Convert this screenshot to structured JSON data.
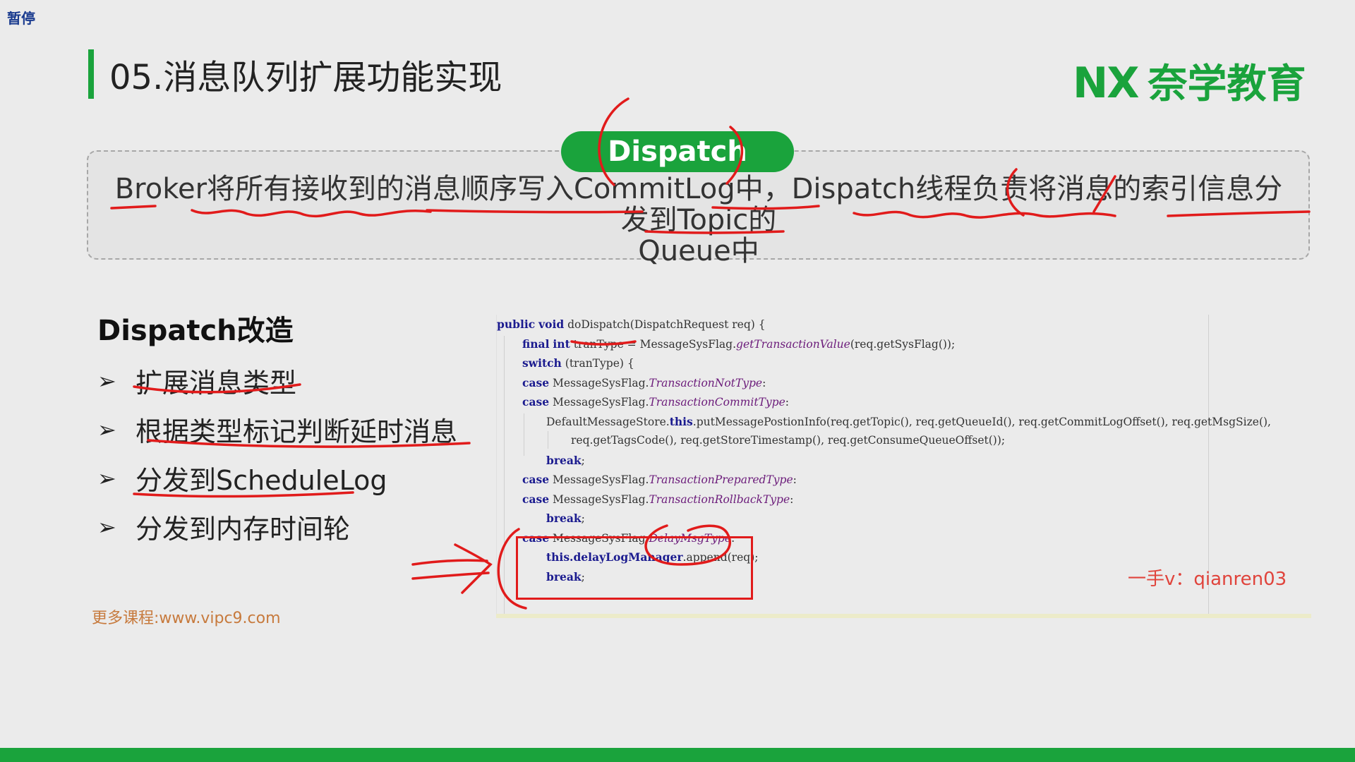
{
  "player": {
    "pause_label": "暂停"
  },
  "slide": {
    "title": "05.消息队列扩展功能实现",
    "logo_mark": "NX",
    "logo_name": "奈学教育",
    "pill": "Dispatch",
    "box_line1": "Broker将所有接收到的消息顺序写入CommitLog中，Dispatch线程负责将消息的索引信息分发到Topic的",
    "box_line2": "Queue中",
    "section_title": "Dispatch改造",
    "bullets": [
      "扩展消息类型",
      "根据类型标记判断延时消息",
      "分发到ScheduleLog",
      "分发到内存时间轮"
    ],
    "bullet_glyph": "➢",
    "site": "更多课程:www.vipc9.com",
    "watermark": "一手v：qianren03"
  },
  "code": {
    "l1": {
      "kw1": "public",
      "kw2": "void",
      "name": "doDispatch",
      "rest": "(DispatchRequest req) {"
    },
    "l2": {
      "kw1": "final",
      "kw2": "int",
      "a": "tranType = MessageSysFlag.",
      "it": "getTransactionValue",
      "b": "(req.getSysFlag());"
    },
    "l3": {
      "kw": "switch",
      "rest": "(tranType) {"
    },
    "l4": {
      "kw": "case",
      "a": "MessageSysFlag.",
      "it": "TransactionNotType",
      "b": ":"
    },
    "l5": {
      "kw": "case",
      "a": "MessageSysFlag.",
      "it": "TransactionCommitType",
      "b": ":"
    },
    "l6": {
      "a": "DefaultMessageStore.",
      "kw": "this",
      "b": ".putMessagePostionInfo(req.getTopic(), req.getQueueId(), req.getCommitLogOffset(), req.getMsgSize(),"
    },
    "l7": {
      "a": "req.getTagsCode(), req.getStoreTimestamp(), req.getConsumeQueueOffset());"
    },
    "l8": {
      "kw": "break",
      "b": ";"
    },
    "l9": {
      "kw": "case",
      "a": "MessageSysFlag.",
      "it": "TransactionPreparedType",
      "b": ":"
    },
    "l10": {
      "kw": "case",
      "a": "MessageSysFlag.",
      "it": "TransactionRollbackType",
      "b": ":"
    },
    "l11": {
      "kw": "break",
      "b": ";"
    },
    "l12": {
      "kw": "case",
      "a": "MessageSysFlag.",
      "it": "DelayMsgType",
      "b": ":"
    },
    "l13": {
      "kw": "this",
      "hl": ".delayLogManager",
      "b": ".append(req);"
    },
    "l14": {
      "kw": "break",
      "b": ";"
    }
  },
  "colors": {
    "brand_green": "#1aa33c",
    "annotation_red": "#e11b1b",
    "site_orange": "#c77a3d"
  }
}
